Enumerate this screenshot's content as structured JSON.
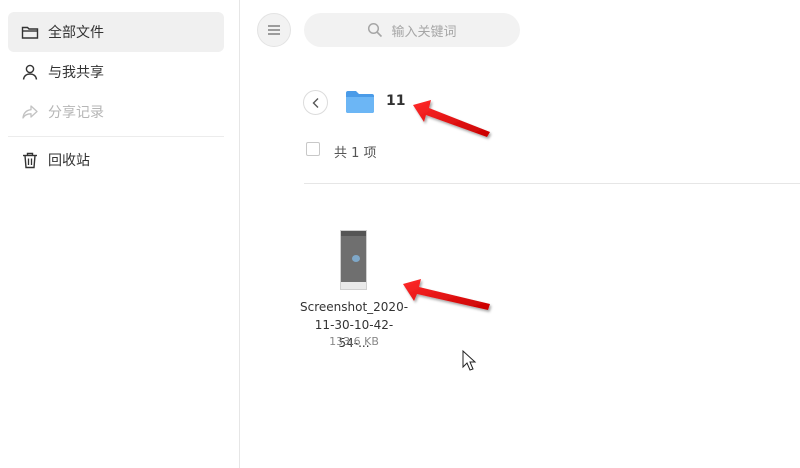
{
  "sidebar": {
    "items": [
      {
        "label": "全部文件",
        "icon": "folder-icon",
        "active": true
      },
      {
        "label": "与我共享",
        "icon": "user-icon",
        "active": false
      },
      {
        "label": "分享记录",
        "icon": "share-icon",
        "disabled": true
      },
      {
        "label": "回收站",
        "icon": "trash-icon",
        "active": false
      }
    ]
  },
  "header": {
    "menu_icon": "hamburger-icon",
    "search": {
      "placeholder": "输入关键词",
      "icon": "search-icon"
    }
  },
  "folder": {
    "name": "11",
    "count_label": "共 1 项"
  },
  "files": [
    {
      "name_line1": "Screenshot_2020-",
      "name_line2": "11-30-10-42-54-...",
      "size": "133.6 KB"
    }
  ],
  "colors": {
    "folder": "#5aa8f0",
    "active_bg": "#f0f0f0",
    "arrow": "#e60000"
  }
}
